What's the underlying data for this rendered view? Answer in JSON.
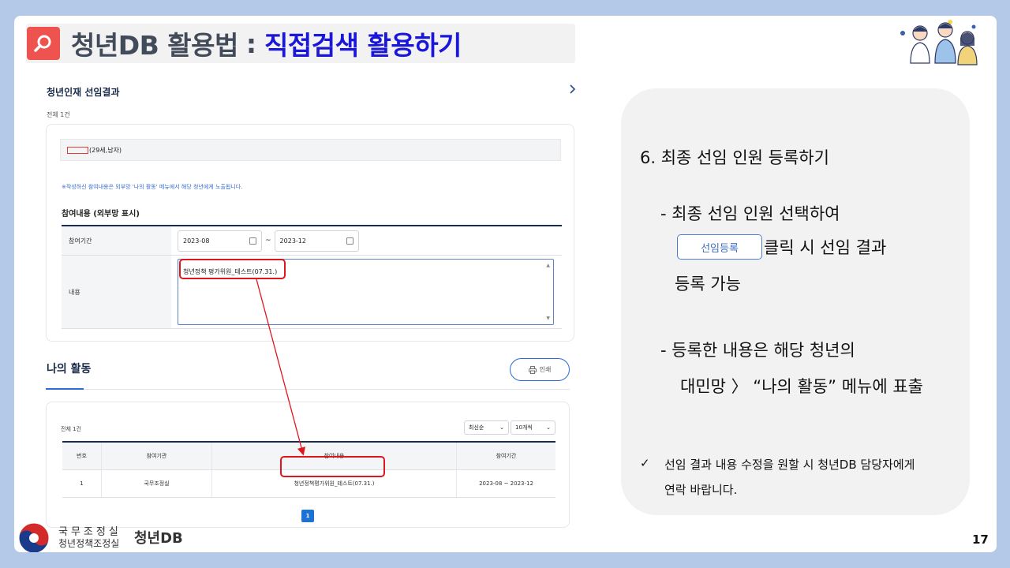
{
  "title": {
    "main": "청년DB 활용법",
    "separator": ":",
    "sub": "직접검색 활용하기"
  },
  "screenshot": {
    "section_title": "청년인재 선임결과",
    "total1": "전체 1건",
    "candidate": "(29세,남자)",
    "notice": "※작성하신 참여내용은 외부망 '나의 활동' 메뉴에서 해당 청년에게 노출됩니다.",
    "participation_label": "참여내용 (외부망 표시)",
    "period_label": "참여기간",
    "start_date": "2023-08",
    "end_date": "2023-12",
    "tilde": "~",
    "content_label": "내용",
    "content_value": "청년정책 평가위원_테스트(07.31.)",
    "my_activity": "나의 활동",
    "print_label": "인쇄",
    "total2": "전체 1건",
    "sort_option": "최신순",
    "count_option": "10개씩",
    "table": {
      "headers": [
        "번호",
        "참여기관",
        "참여내용",
        "참여기간"
      ],
      "rows": [
        [
          "1",
          "국무조정실",
          "청년정책평가위원_테스트(07.31.)",
          "2023-08 ~ 2023-12"
        ]
      ]
    },
    "page": "1"
  },
  "panel": {
    "step": "6.  최종 선임 인원 등록하기",
    "bullet1_a": "- 최종 선임 인원 선택하여",
    "register_button": "선임등록",
    "bullet1_b": "클릭 시 선임 결과",
    "bullet1_c": "등록 가능",
    "bullet2_a": "- 등록한 내용은 해당 청년의",
    "bullet2_b": "대민망 〉 “나의 활동” 메뉴에 표출",
    "check": "✓",
    "note_line1": "선임 결과 내용 수정을 원할 시 청년DB 담당자에게",
    "note_line2": "연락 바랍니다."
  },
  "footer": {
    "org_line1": "국무조정실",
    "org_line2": "청년정책조정실",
    "brand": "청년DB",
    "page_number": "17"
  },
  "colors": {
    "accent_red": "#e0161e",
    "title_blue": "#1b17d8",
    "button_blue": "#4a7fd0",
    "background": "#b4c9e8"
  }
}
